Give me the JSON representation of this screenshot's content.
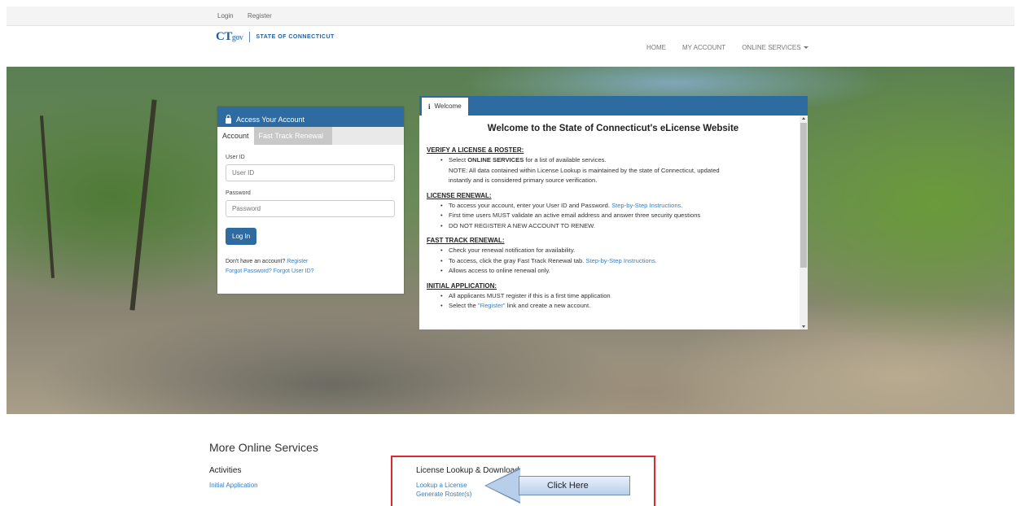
{
  "utility": {
    "login": "Login",
    "register": "Register"
  },
  "header": {
    "logo_mark": "CT",
    "logo_gov": "gov",
    "state": "STATE OF CONNECTICUT",
    "nav": {
      "home": "HOME",
      "account": "MY ACCOUNT",
      "services": "ONLINE SERVICES"
    }
  },
  "login": {
    "panel_title": "Access Your Account",
    "tab_account": "Account",
    "tab_fast": "Fast Track Renewal",
    "user_label": "User ID",
    "user_placeholder": "User ID",
    "password_label": "Password",
    "password_placeholder": "Password",
    "button": "Log In",
    "no_account_text": "Don't have an account?",
    "register_link": "Register",
    "forgot_password": "Forgot Password?",
    "forgot_user": "Forgot User ID?"
  },
  "welcome": {
    "tab": "Welcome",
    "title": "Welcome to the State of Connecticut's eLicense Website",
    "verify": {
      "head": "VERIFY A LICENSE & ROSTER:",
      "l1_pre": "Select ",
      "l1_bold": "ONLINE SERVICES",
      "l1_post": " for a list of available services.",
      "l2": "NOTE: All data contained within License Lookup is maintained by the state of Connecticut, updated",
      "l3": "instantly and is considered primary source verification."
    },
    "renewal": {
      "head": "LICENSE RENEWAL:",
      "l1": "To access your account, enter your User ID and Password.",
      "l1_link": "Step-by-Step Instructions.",
      "l2": "First time users MUST validate an active email address and answer three security questions",
      "l3": "DO NOT REGISTER A NEW ACCOUNT TO RENEW."
    },
    "fast_track": {
      "head": "FAST TRACK RENEWAL:",
      "l1": "Check your renewal notification for availability.",
      "l2": "To access, click the gray Fast Track Renewal tab.",
      "l2_link": "Step-by-Step Instructions.",
      "l3": "Allows access to online renewal only."
    },
    "initial": {
      "head": "INITIAL APPLICATION:",
      "l1": "All applicants MUST register if this is a first time application",
      "l2_pre": "Select the ",
      "l2_link": "\"Register\"",
      "l2_post": " link and create a new account."
    }
  },
  "more_services": {
    "title": "More Online Services",
    "activities_head": "Activities",
    "initial_application": "Initial Application",
    "lookup_head": "License Lookup & Download",
    "lookup_license": "Lookup a License",
    "generate_roster": "Generate Roster(s)"
  },
  "callout": {
    "text": "Click Here"
  },
  "colors": {
    "brand": "#2d6ba0",
    "link": "#3a7dbf",
    "highlight": "#e0262e"
  }
}
